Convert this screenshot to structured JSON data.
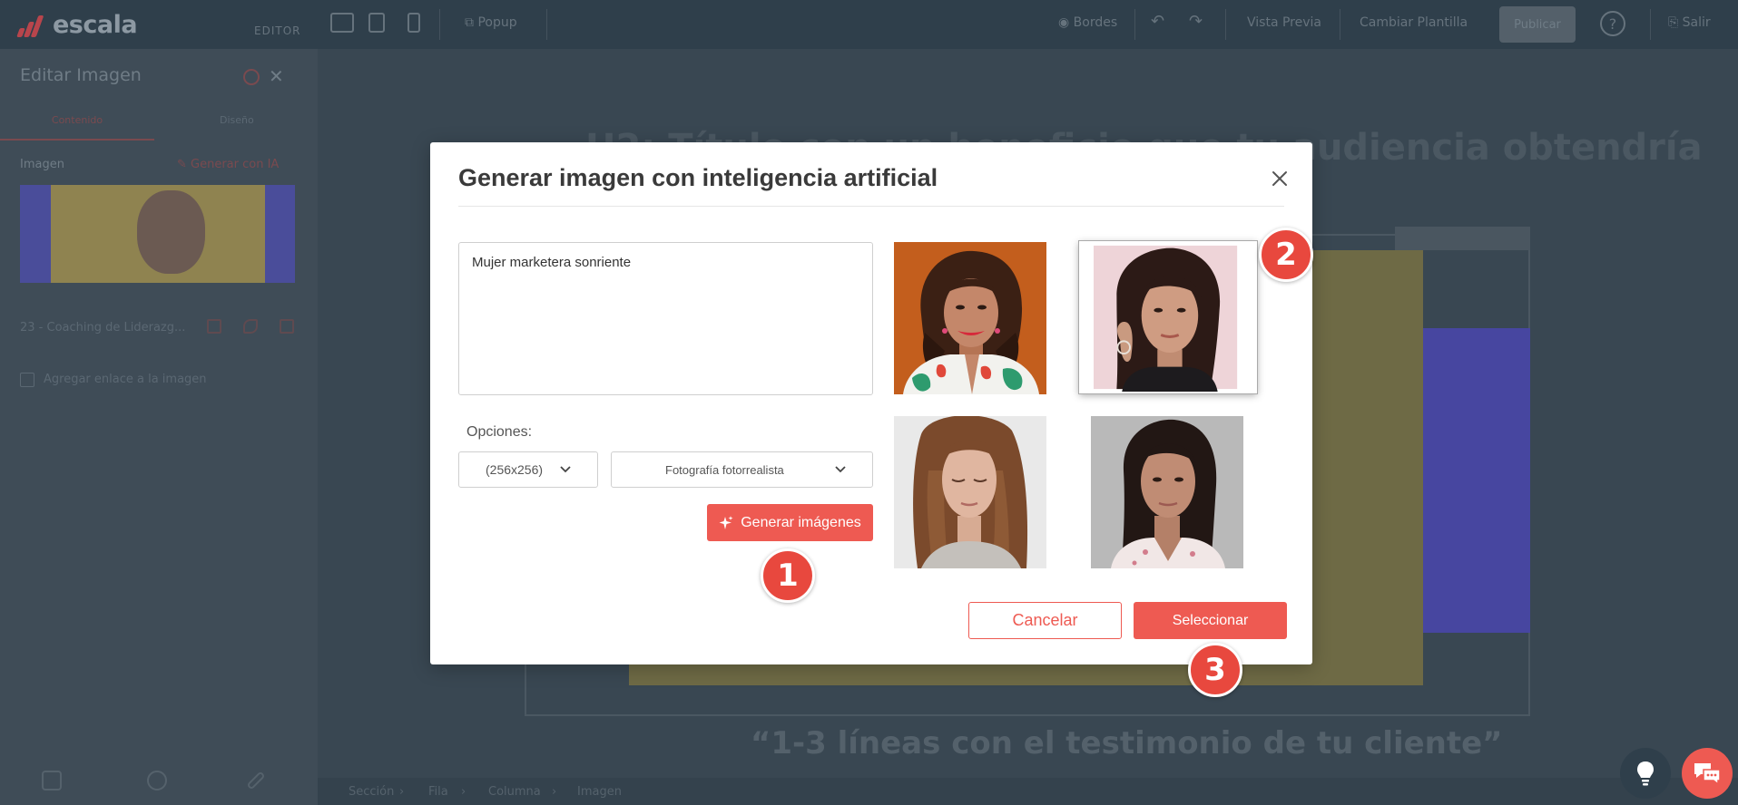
{
  "app": {
    "logo_text": "escala",
    "mode_label": "EDITOR",
    "popup_label": "Popup",
    "borders_label": "Bordes",
    "preview_label": "Vista Previa",
    "change_template_label": "Cambiar Plantilla",
    "publish_label": "Publicar",
    "help_label": "?",
    "exit_label": "Salir"
  },
  "sidebar": {
    "title": "Editar Imagen",
    "tabs": [
      "Contenido",
      "Diseño"
    ],
    "image_label": "Imagen",
    "generate_ai_label": "Generar con IA",
    "file_name": "23 - Coaching de Liderazg...",
    "link_checkbox_label": "Agregar enlace a la imagen"
  },
  "canvas": {
    "heading": "H2: Título con un beneficio que tu audiencia obtendría",
    "quote": "“1-3 líneas con el testimonio de tu cliente”",
    "breadcrumb": [
      "Sección",
      "Fila",
      "Columna",
      "Imagen"
    ]
  },
  "modal": {
    "title": "Generar imagen con inteligencia artificial",
    "prompt_value": "Mujer marketera sonriente",
    "options_label": "Opciones:",
    "size_value": "(256x256)",
    "style_value": "Fotografía fotorrealista",
    "generate_label": "Generar imágenes",
    "cancel_label": "Cancelar",
    "select_label": "Seleccionar",
    "images": [
      {
        "name": "woman-orange-background",
        "selected": false
      },
      {
        "name": "woman-pink-background",
        "selected": true
      },
      {
        "name": "woman-eyes-closed",
        "selected": false
      },
      {
        "name": "woman-white-blouse",
        "selected": false
      }
    ]
  },
  "annotations": {
    "step1": "1",
    "step2": "2",
    "step3": "3"
  },
  "colors": {
    "accent": "#ee5a52",
    "step_badge": "#e8483e",
    "overlay_bg": "#3b4a56"
  }
}
